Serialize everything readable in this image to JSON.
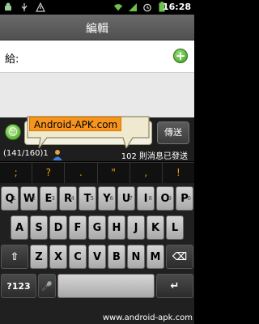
{
  "status_bar": {
    "time": "16:28"
  },
  "title_bar": {
    "title": "編輯"
  },
  "recipient": {
    "label": "給:",
    "value": "",
    "add_symbol": "+"
  },
  "compose": {
    "emoji_symbol": "☺",
    "banner_text": "Android-APK.com",
    "send_label": "傳送",
    "char_count": "(141/160)1",
    "message_count": "102 則消息已發送"
  },
  "suggestions": [
    ";",
    "?",
    ".",
    "\"",
    ",",
    "!"
  ],
  "keyboard": {
    "row1": [
      "Q",
      "W",
      "E",
      "R",
      "T",
      "Y",
      "U",
      "I",
      "O",
      "P"
    ],
    "row1_sub": [
      "1",
      "2",
      "3",
      "4",
      "5",
      "6",
      "7",
      "8",
      "9",
      "0"
    ],
    "row2": [
      "A",
      "S",
      "D",
      "F",
      "G",
      "H",
      "J",
      "K",
      "L"
    ],
    "row3": [
      "Z",
      "X",
      "C",
      "V",
      "B",
      "N",
      "M"
    ],
    "shift_label": "⇧",
    "delete_label": "⌫",
    "symbols_label": "?123",
    "mic_label": "🎤",
    "enter_label": "↵"
  },
  "watermark": "www.android-apk.com"
}
